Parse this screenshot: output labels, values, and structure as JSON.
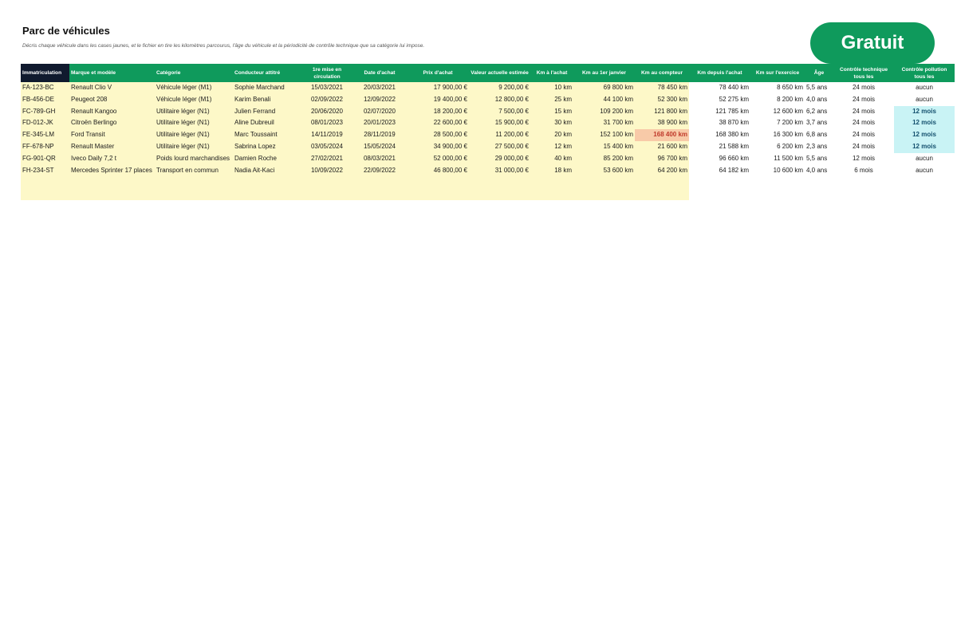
{
  "page": {
    "title": "Parc de véhicules",
    "subtitle": "Décris chaque véhicule dans les cases jaunes, et le fichier en tire les kilomètres parcourus, l'âge du véhicule et la périodicité de contrôle technique que sa catégorie lui impose.",
    "badge": "Gratuit"
  },
  "colors": {
    "header_green": "#0f9a5c",
    "header_first": "#101a2e",
    "input_yellow": "#fdf8c8",
    "alert_orange": "#f8caa8",
    "highlight_cyan": "#c9f3f5"
  },
  "table": {
    "headers": [
      "Immatriculation",
      "Marque et modèle",
      "Catégorie",
      "Conducteur attitré",
      "1re mise en circulation",
      "Date d'achat",
      "Prix d'achat",
      "Valeur actuelle estimée",
      "Km à l'achat",
      "Km au 1er janvier",
      "Km au compteur",
      "Km depuis l'achat",
      "Km sur l'exercice",
      "Âge",
      "Contrôle technique tous les",
      "Contrôle pollution tous les"
    ],
    "rows": [
      [
        "FA-123-BC",
        "Renault Clio V",
        "Véhicule léger (M1)",
        "Sophie Marchand",
        "15/03/2021",
        "20/03/2021",
        "17 900,00 €",
        "9 200,00 €",
        "10 km",
        "69 800 km",
        "78 450 km",
        "78 440 km",
        "8 650 km",
        "5,5 ans",
        "24 mois",
        "aucun"
      ],
      [
        "FB-456-DE",
        "Peugeot 208",
        "Véhicule léger (M1)",
        "Karim Benali",
        "02/09/2022",
        "12/09/2022",
        "19 400,00 €",
        "12 800,00 €",
        "25 km",
        "44 100 km",
        "52 300 km",
        "52 275 km",
        "8 200 km",
        "4,0 ans",
        "24 mois",
        "aucun"
      ],
      [
        "FC-789-GH",
        "Renault Kangoo",
        "Utilitaire léger (N1)",
        "Julien Ferrand",
        "20/06/2020",
        "02/07/2020",
        "18 200,00 €",
        "7 500,00 €",
        "15 km",
        "109 200 km",
        "121 800 km",
        "121 785 km",
        "12 600 km",
        "6,2 ans",
        "24 mois",
        "12 mois"
      ],
      [
        "FD-012-JK",
        "Citroën Berlingo",
        "Utilitaire léger (N1)",
        "Aline Dubreuil",
        "08/01/2023",
        "20/01/2023",
        "22 600,00 €",
        "15 900,00 €",
        "30 km",
        "31 700 km",
        "38 900 km",
        "38 870 km",
        "7 200 km",
        "3,7 ans",
        "24 mois",
        "12 mois"
      ],
      [
        "FE-345-LM",
        "Ford Transit",
        "Utilitaire léger (N1)",
        "Marc Toussaint",
        "14/11/2019",
        "28/11/2019",
        "28 500,00 €",
        "11 200,00 €",
        "20 km",
        "152 100 km",
        "168 400 km",
        "168 380 km",
        "16 300 km",
        "6,8 ans",
        "24 mois",
        "12 mois"
      ],
      [
        "FF-678-NP",
        "Renault Master",
        "Utilitaire léger (N1)",
        "Sabrina Lopez",
        "03/05/2024",
        "15/05/2024",
        "34 900,00 €",
        "27 500,00 €",
        "12 km",
        "15 400 km",
        "21 600 km",
        "21 588 km",
        "6 200 km",
        "2,3 ans",
        "24 mois",
        "12 mois"
      ],
      [
        "FG-901-QR",
        "Iveco Daily 7,2 t",
        "Poids lourd marchandises",
        "Damien Roche",
        "27/02/2021",
        "08/03/2021",
        "52 000,00 €",
        "29 000,00 €",
        "40 km",
        "85 200 km",
        "96 700 km",
        "96 660 km",
        "11 500 km",
        "5,5 ans",
        "12 mois",
        "aucun"
      ],
      [
        "FH-234-ST",
        "Mercedes Sprinter 17 places",
        "Transport en commun",
        "Nadia Ait-Kaci",
        "10/09/2022",
        "22/09/2022",
        "46 800,00 €",
        "31 000,00 €",
        "18 km",
        "53 600 km",
        "64 200 km",
        "64 182 km",
        "10 600 km",
        "4,0 ans",
        "6 mois",
        "aucun"
      ]
    ]
  }
}
